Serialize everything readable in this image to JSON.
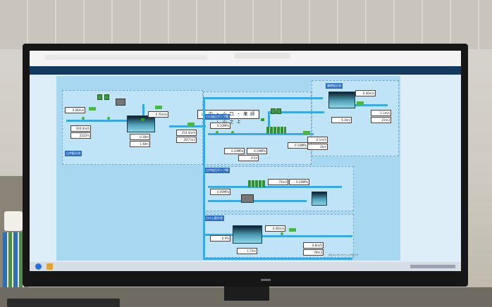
{
  "scene": {
    "colors": {
      "scada_bg": "#a8d7f2",
      "panel_bg": "#bfe3f7",
      "pipe": "#3ba9e0",
      "section_label": "#2f6fc2",
      "tank": "#4fa0b8",
      "pump": "#3d9b45"
    }
  },
  "scada": {
    "title": "山 中 ・ 小 口 ・ 薬 師 ・ 山 之 上",
    "section_left": "山中配水池",
    "section_top": "小口加圧ポンプ場",
    "section_mid": "山中加圧ポンプ場",
    "section_low": "小口上配水池",
    "section_right": "薬師配水池",
    "footer": "のるトレサイツとリックポンプ",
    "values": {
      "v1": "0.08m/s",
      "v2": "0.75m/s",
      "v3": "344.4m/h",
      "v4": "2222m",
      "v5": "0.38m",
      "v6": "1.48m",
      "v7": "254.4m/h",
      "v8": "2617m3",
      "v9": "0.10MPa",
      "v10": "0.10MPa",
      "v11": "0.5h",
      "v12": "0.19MPa",
      "v13": "0.10MPa",
      "v14": "-0.1m/h",
      "v15": "4km",
      "v16": "0.06m/s",
      "v17": "1.1m/s",
      "v18": "15m3",
      "v19": "5.30m",
      "v20": "0.06MPa",
      "v21": "0.16MPa",
      "v22": "75m3",
      "v23": "0.9%",
      "v24": "0.04m/s",
      "v25": "1.75m",
      "v26": "0.8m/h",
      "v27": "78m3"
    }
  }
}
